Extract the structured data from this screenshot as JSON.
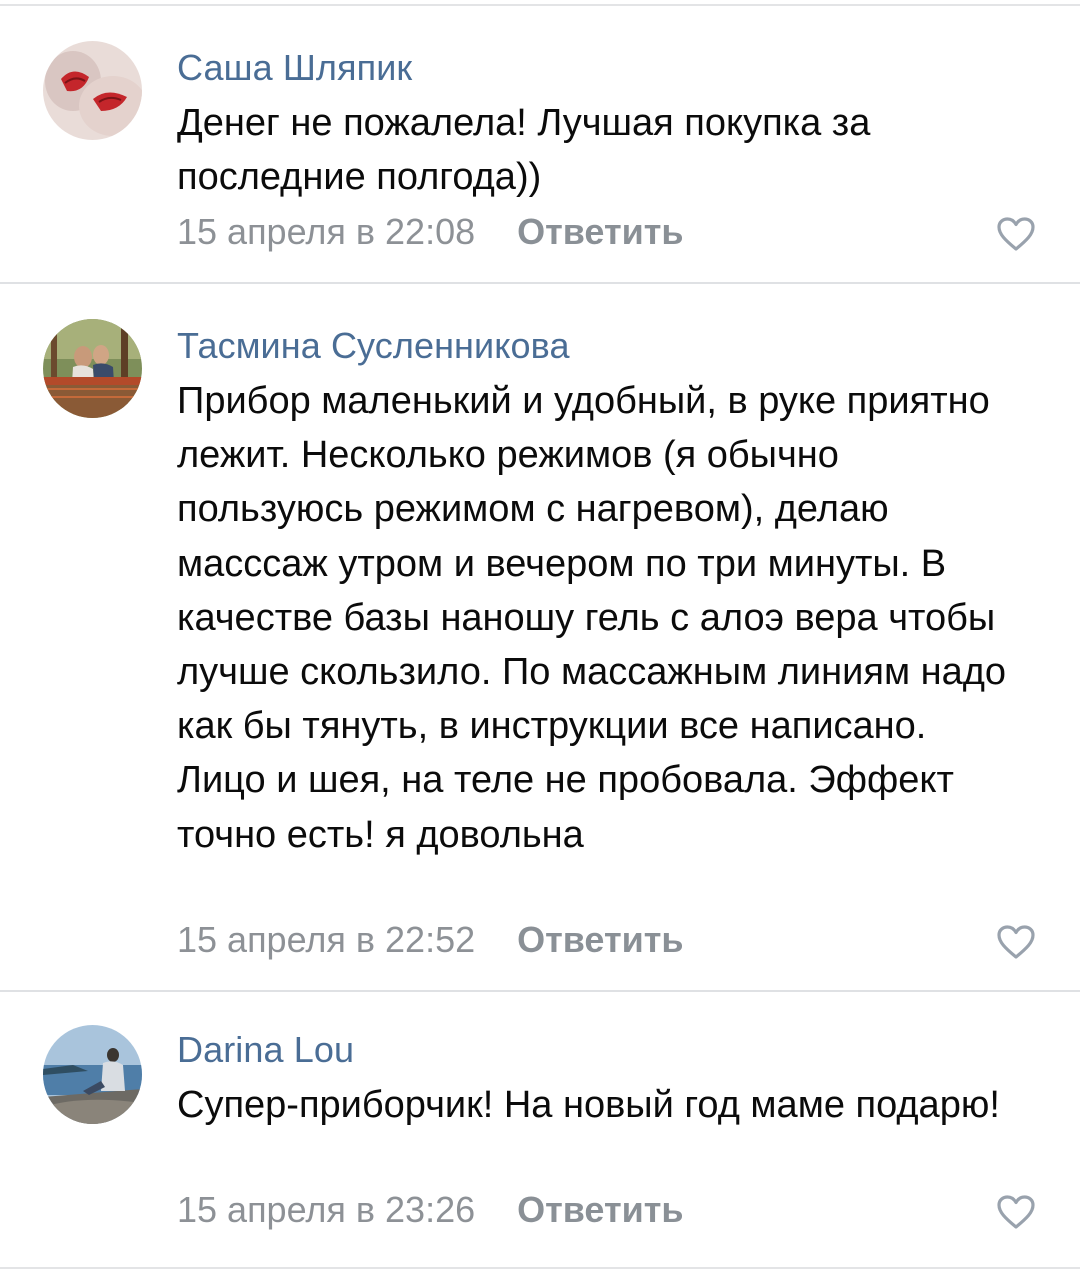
{
  "comments": [
    {
      "author": "Саша Шляпик",
      "text": "Денег не пожалела! Лучшая покупка за последние полгода))",
      "date": "15 апреля в 22:08",
      "reply_label": "Ответить"
    },
    {
      "author": "Тасмина Сусленникова",
      "text": "Прибор маленький и удобный, в руке приятно лежит. Несколько режимов (я обычно пользуюсь режимом с нагревом), делаю масссаж утром и вечером по три минуты. В качестве базы наношу гель с алоэ вера чтобы лучше скользило. По массажным линиям надо как бы тянуть, в инструкции все написано. Лицо и шея, на теле не пробовала. Эффект точно есть! я довольна",
      "date": "15 апреля в 22:52",
      "reply_label": "Ответить"
    },
    {
      "author": "Darina Lou",
      "text": "Супер-приборчик! На новый год маме подарю!",
      "date": "15 апреля в 23:26",
      "reply_label": "Ответить"
    }
  ],
  "icons": {
    "like": "heart-outline-icon"
  },
  "colors": {
    "author": "#4a6d95",
    "meta": "#8d9196",
    "divider": "#dfe1e4",
    "heart": "#99a2ad"
  }
}
